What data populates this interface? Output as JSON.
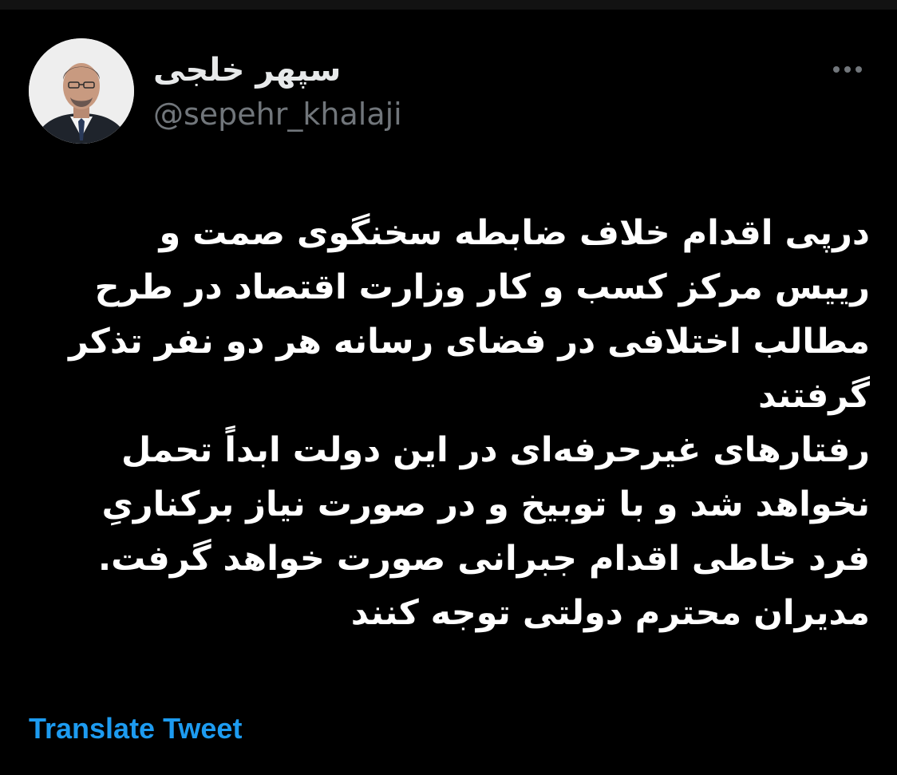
{
  "colors": {
    "background": "#000000",
    "text": "#ffffff",
    "secondary_text": "#71767b",
    "link": "#1d9bf0"
  },
  "author": {
    "display_name": "سپهر خلجی",
    "handle": "@sepehr_khalaji",
    "avatar_icon": "profile-photo"
  },
  "more_icon": "more-dots-icon",
  "tweet": {
    "lines": [
      "درپی اقدام خلاف ضابطه سخنگوی صمت و",
      "رییس مرکز کسب و کار وزارت اقتصاد در طرح",
      "مطالب اختلافی در فضای رسانه هر دو نفر تذکر",
      "گرفتند",
      "رفتارهای غیرحرفه‌ای در این دولت ابداً تحمل",
      "نخواهد شد و با توبیخ و در صورت نیاز برکناریِ",
      "فرد خاطی اقدام جبرانی صورت خواهد گرفت.",
      "مدیران محترم دولتی توجه کنند"
    ]
  },
  "translate_label": "Translate Tweet"
}
